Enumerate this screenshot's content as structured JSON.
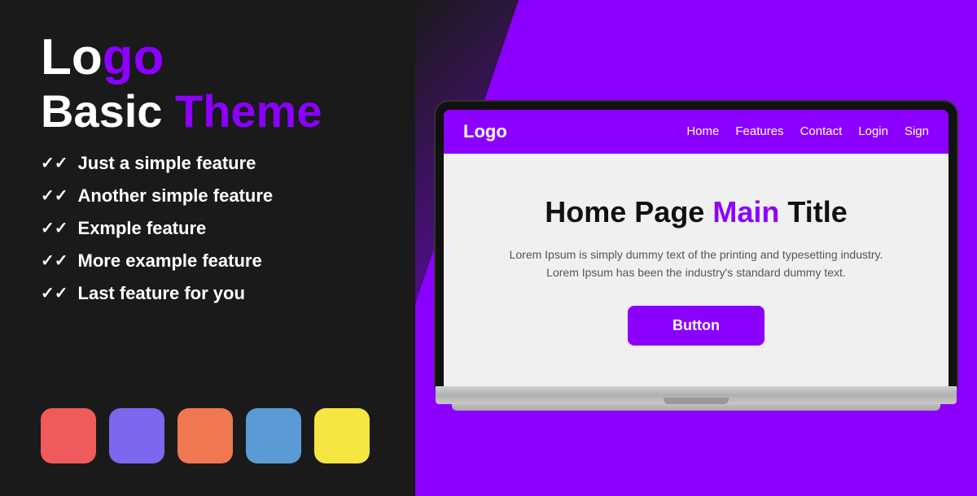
{
  "left": {
    "logo": {
      "text_white": "Lo",
      "text_purple": "go",
      "tagline_white": "Basic ",
      "tagline_purple": "Theme"
    },
    "features": [
      "Just a simple feature",
      "Another simple feature",
      "Exmple feature",
      "More example feature",
      "Last feature for you"
    ],
    "swatches": [
      {
        "name": "red",
        "color": "#f05a5a"
      },
      {
        "name": "purple",
        "color": "#7b68ee"
      },
      {
        "name": "orange",
        "color": "#f07850"
      },
      {
        "name": "blue",
        "color": "#5b9bd5"
      },
      {
        "name": "yellow",
        "color": "#f5e642"
      }
    ]
  },
  "laptop": {
    "navbar": {
      "logo": "Logo",
      "links": [
        "Home",
        "Features",
        "Contact",
        "Login",
        "Sign"
      ]
    },
    "hero": {
      "title_black": "Home Page ",
      "title_purple": "Main",
      "title_black2": " Title",
      "body": "Lorem Ipsum is simply dummy text of the printing and typesetting industry.\nLorem Ipsum has been the industry's standard dummy text.",
      "button": "Button"
    }
  }
}
